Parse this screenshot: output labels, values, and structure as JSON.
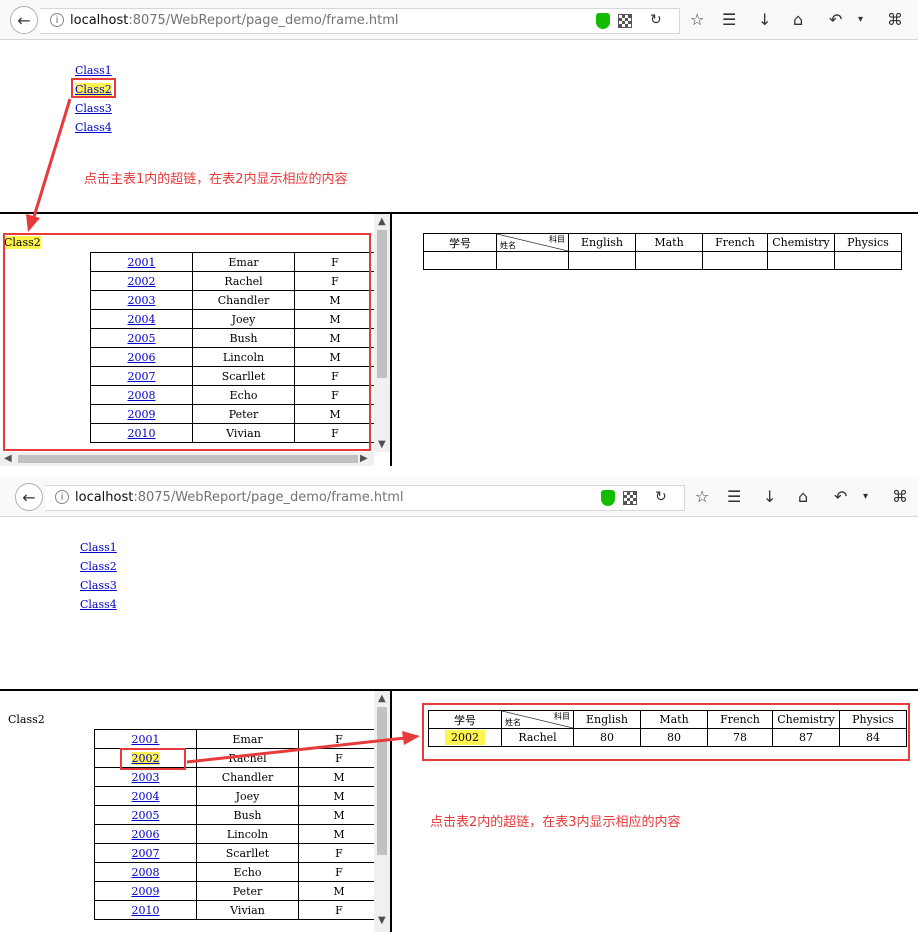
{
  "browser": {
    "url_host": "localhost",
    "url_rest": ":8075/WebReport/page_demo/frame.html"
  },
  "classes": [
    "Class1",
    "Class2",
    "Class3",
    "Class4"
  ],
  "selected_class": "Class2",
  "annotations": {
    "step1": "点击主表1内的超链，在表2内显示相应的内容",
    "step2": "点击表2内的超链，在表3内显示相应的内容"
  },
  "students": [
    {
      "id": "2001",
      "name": "Emar",
      "gender": "F"
    },
    {
      "id": "2002",
      "name": "Rachel",
      "gender": "F"
    },
    {
      "id": "2003",
      "name": "Chandler",
      "gender": "M"
    },
    {
      "id": "2004",
      "name": "Joey",
      "gender": "M"
    },
    {
      "id": "2005",
      "name": "Bush",
      "gender": "M"
    },
    {
      "id": "2006",
      "name": "Lincoln",
      "gender": "M"
    },
    {
      "id": "2007",
      "name": "Scarllet",
      "gender": "F"
    },
    {
      "id": "2008",
      "name": "Echo",
      "gender": "F"
    },
    {
      "id": "2009",
      "name": "Peter",
      "gender": "M"
    },
    {
      "id": "2010",
      "name": "Vivian",
      "gender": "F"
    }
  ],
  "score_table": {
    "id_header": "学号",
    "diag_top": "科目",
    "diag_bottom": "姓名",
    "subjects": [
      "English",
      "Math",
      "French",
      "Chemistry",
      "Physics"
    ],
    "row": {
      "id": "2002",
      "name": "Rachel",
      "scores": [
        "80",
        "80",
        "78",
        "87",
        "84"
      ]
    }
  },
  "colors": {
    "annotation_red": "#e8393b",
    "highlight_yellow": "#fff44f",
    "link_blue": "#0000cc"
  }
}
